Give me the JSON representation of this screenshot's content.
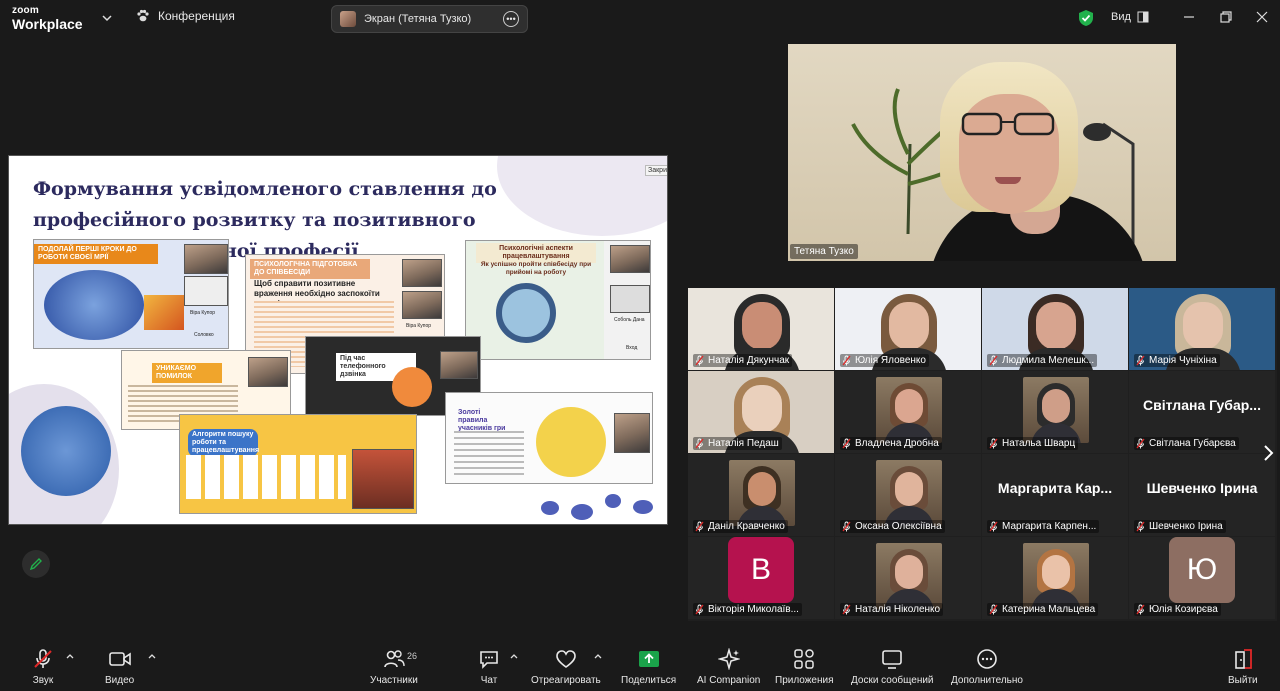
{
  "app": {
    "logo_line1": "zoom",
    "logo_line2": "Workplace",
    "meeting_label": "Конференция",
    "screen_share_label": "Экран (Тетяна Тузко)",
    "view_label": "Вид",
    "secure_color": "#22b14c"
  },
  "slide": {
    "title": "Формування усвідомленого ставлення до професійного розвитку та позитивного сприйняття обраної професії",
    "close_label": "Закрити",
    "card1_tag": "ПОДОЛАЙ ПЕРШІ КРОКИ ДО РОБОТИ СВОЄЇ МРІЇ",
    "card2_tag": "ПСИХОЛОГІЧНА ПІДГОТОВКА ДО СПІВБЕСІДИ",
    "card2_sub": "Щоб справити позитивне враження необхідно заспокоїти власні почуття",
    "card3_tag": "Психологічні аспекти працевлаштування",
    "card3_sub": "Як успішно пройти співбесіду при прийомі на роботу",
    "card4_tag": "УНИКАЄМО ПОМИЛОК",
    "card5_tag": "Під час телефонного дзвінка",
    "card6_tag": "Алгоритм пошуку роботи та працевлаштування",
    "card7_tag": "Золоті правила учасників гри",
    "mini1": "Віра Купор",
    "mini2": "Соловко",
    "mini3": "Віра Купор",
    "mini4": "Соболь Дана",
    "mini5": "Вход"
  },
  "speaker": {
    "name": "Тетяна Тузко"
  },
  "gallery": [
    {
      "name": "Наталія Дякунчак",
      "kind": "photo",
      "bg": "#e9e4dc"
    },
    {
      "name": "Юлія Яловенко",
      "kind": "photo",
      "bg": "#eef0f4"
    },
    {
      "name": "Людмила Мелешк...",
      "kind": "photo",
      "bg": "#cfd9e8"
    },
    {
      "name": "Марія Чуніхіна",
      "kind": "photo",
      "bg": "#2b5a86"
    },
    {
      "name": "Наталія Педаш",
      "kind": "photo",
      "bg": "#d8cfc3"
    },
    {
      "name": "Владлена Дробна",
      "kind": "photo",
      "bg": "#242424"
    },
    {
      "name": "Натальа Шварц",
      "kind": "photo",
      "bg": "#242424"
    },
    {
      "name": "Світлана Губарєва",
      "kind": "text",
      "big": "Світлана Губар..."
    },
    {
      "name": "Даніл Кравченко",
      "kind": "photo",
      "bg": "#242424"
    },
    {
      "name": "Оксана Олексіївна",
      "kind": "photo",
      "bg": "#242424"
    },
    {
      "name": "Маргарита Карпен...",
      "kind": "text",
      "big": "Маргарита Кар..."
    },
    {
      "name": "Шевченко Ірина",
      "kind": "text",
      "big": "Шевченко Ірина"
    },
    {
      "name": "Вікторія Миколаїв...",
      "kind": "letter",
      "letter": "В",
      "color": "#b5124e"
    },
    {
      "name": "Наталія Ніколенко",
      "kind": "photo",
      "bg": "#242424"
    },
    {
      "name": "Катерина Мальцева",
      "kind": "photo",
      "bg": "#242424"
    },
    {
      "name": "Юлія Козирєва",
      "kind": "letter",
      "letter": "Ю",
      "color": "#8d6e62"
    }
  ],
  "toolbar": {
    "audio": "Звук",
    "video": "Видео",
    "participants": "Участники",
    "participants_count": "26",
    "chat": "Чат",
    "react": "Отреагировать",
    "share": "Поделиться",
    "share_color": "#1aa34a",
    "ai": "AI Companion",
    "apps": "Приложения",
    "whiteboards": "Доски сообщений",
    "more": "Дополнительно",
    "leave": "Выйти",
    "leave_color": "#e02828"
  }
}
